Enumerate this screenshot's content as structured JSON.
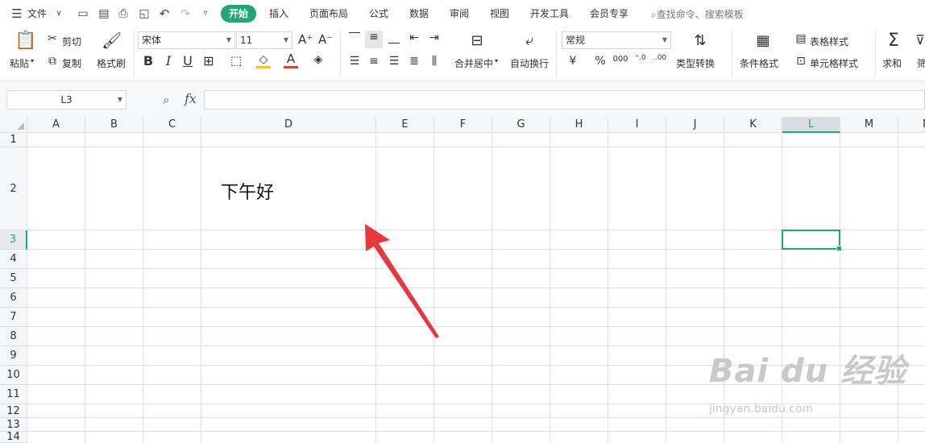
{
  "menubar": {
    "file": "文件",
    "tabs": [
      "开始",
      "插入",
      "页面布局",
      "公式",
      "数据",
      "审阅",
      "视图",
      "开发工具",
      "会员专享"
    ],
    "search": "查找命令、搜索模板"
  },
  "ribbon": {
    "paste": "粘贴",
    "cut": "剪切",
    "copy": "复制",
    "format_painter": "格式刷",
    "font_name": "宋体",
    "font_size": "11",
    "merge_center": "合并居中",
    "wrap_text": "自动换行",
    "number_format": "常规",
    "type_convert": "类型转换",
    "cond_format": "条件格式",
    "table_style": "表格样式",
    "cell_style": "单元格样式",
    "sum": "求和",
    "filter": "筛"
  },
  "formula_bar": {
    "name_box": "L3",
    "fx": "fx",
    "value": ""
  },
  "sheet": {
    "columns": [
      "A",
      "B",
      "C",
      "D",
      "E",
      "F",
      "G",
      "H",
      "I",
      "J",
      "K",
      "L",
      "M",
      "N"
    ],
    "rows": [
      "1",
      "2",
      "3",
      "4",
      "5",
      "6",
      "7",
      "8",
      "9",
      "10",
      "11",
      "12",
      "13",
      "14"
    ],
    "selected_column": "L",
    "selected_row": "3",
    "cell_D2": "下午好"
  },
  "watermark": {
    "brand": "Bai du 经验",
    "url": "jingyan.baidu.com"
  },
  "colors": {
    "accent": "#1ea876",
    "arrow": "#e8383d"
  }
}
